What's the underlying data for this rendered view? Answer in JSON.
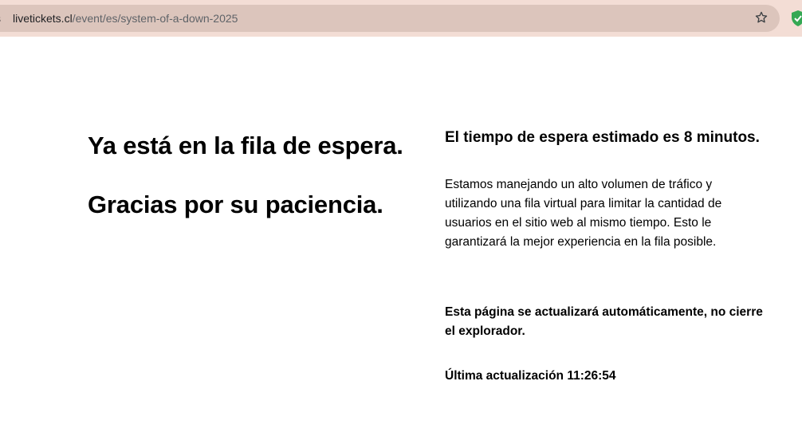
{
  "browser": {
    "url_host": "livetickets.cl",
    "url_path": "/event/es/system-of-a-down-2025",
    "site_info_glyph": "s",
    "bookmark_icon": "star-icon",
    "extension_icon": "shield-icon",
    "extension_color": "#34a853"
  },
  "queue": {
    "heading_primary": "Ya está en la fila de espera.",
    "heading_secondary": "Gracias por su paciencia.",
    "wait_title": "El tiempo de espera estimado es 8 minutos.",
    "description": "Estamos manejando un alto volumen de tráfico y utilizando una fila virtual para limitar la cantidad de usuarios en el sitio web al mismo tiempo. Esto le garantizará la mejor experiencia en la fila posible.",
    "auto_refresh_notice": "Esta página se actualizará automáticamente, no cierre el explorador.",
    "last_updated": "Última actualización 11:26:54"
  }
}
